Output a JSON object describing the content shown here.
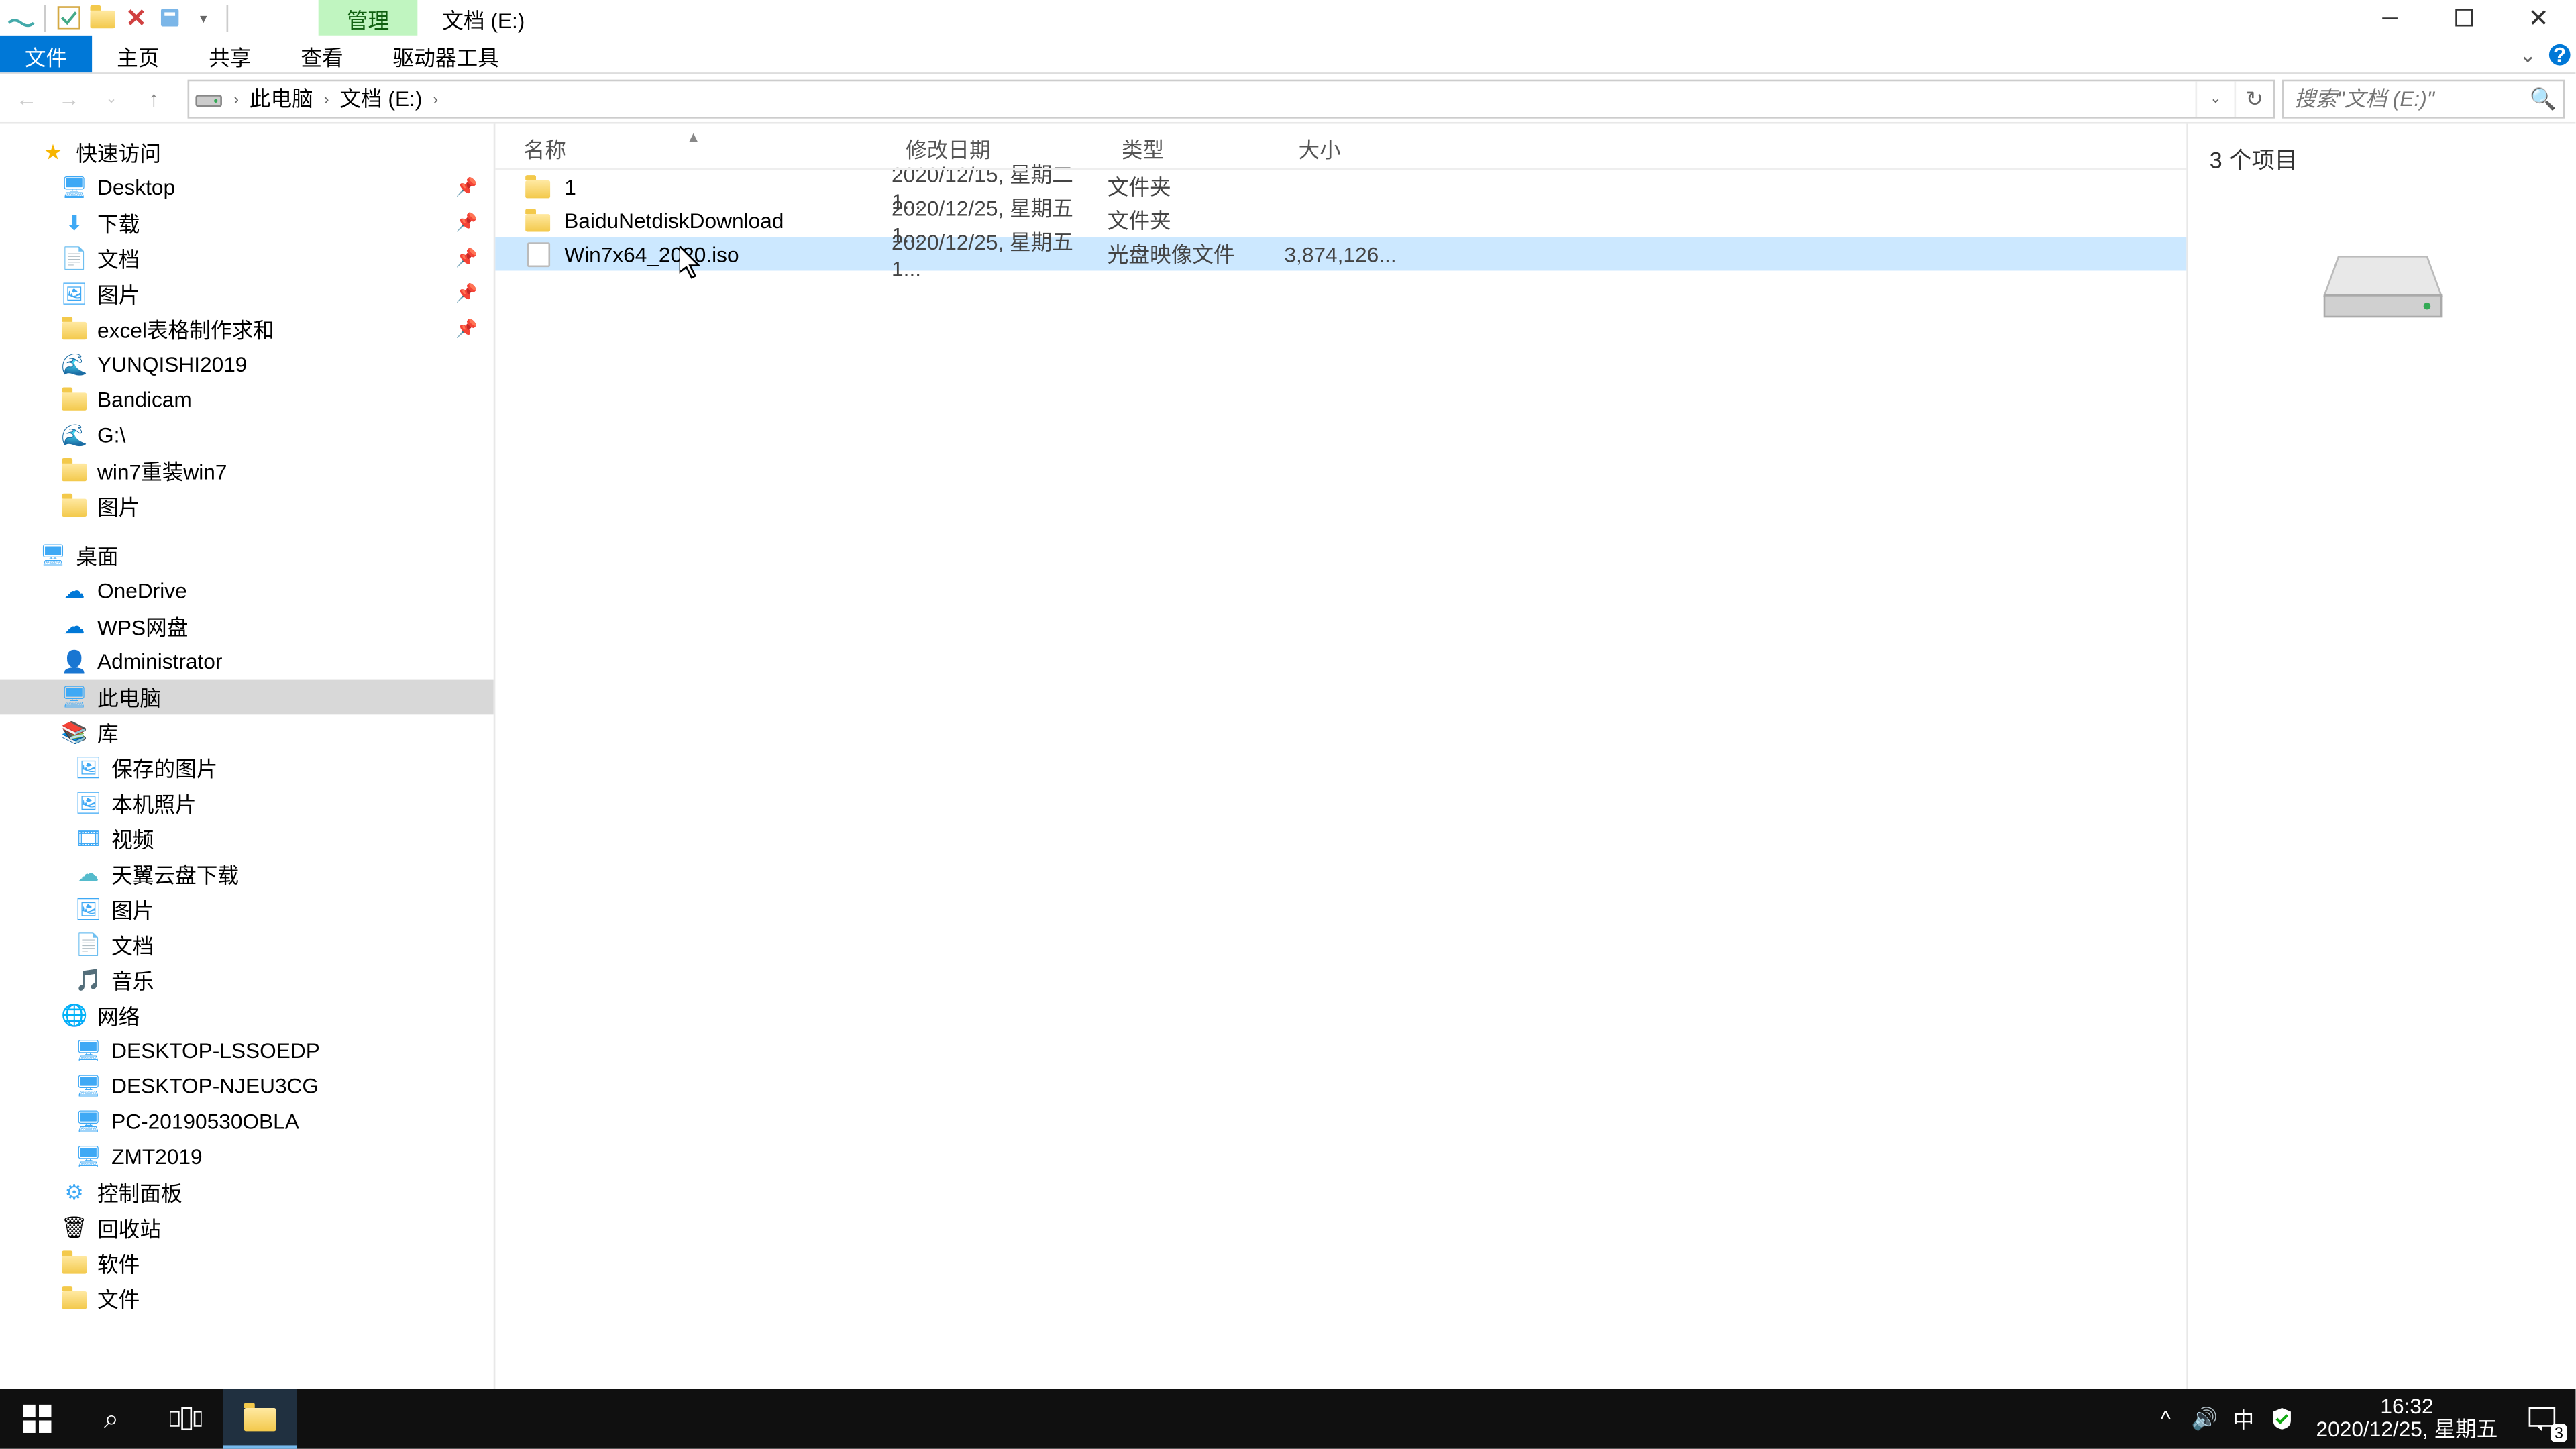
{
  "titlebar": {
    "manage_tab": "管理",
    "location_tab": "文档 (E:)"
  },
  "ribbon": {
    "file": "文件",
    "home": "主页",
    "share": "共享",
    "view": "查看",
    "drive_tools": "驱动器工具"
  },
  "breadcrumb": {
    "this_pc": "此电脑",
    "location": "文档 (E:)"
  },
  "search": {
    "placeholder": "搜索\"文档 (E:)\""
  },
  "nav": {
    "quick_access": "快速访问",
    "desktop": "Desktop",
    "downloads": "下载",
    "documents": "文档",
    "pictures": "图片",
    "excel_folder": "excel表格制作求和",
    "yunqishi": "YUNQISHI2019",
    "bandicam": "Bandicam",
    "g_drive": "G:\\",
    "win7": "win7重装win7",
    "pictures2": "图片",
    "desktop2": "桌面",
    "onedrive": "OneDrive",
    "wps": "WPS网盘",
    "admin": "Administrator",
    "this_pc": "此电脑",
    "libraries": "库",
    "saved_pics": "保存的图片",
    "camera_roll": "本机照片",
    "videos": "视频",
    "tianyi": "天翼云盘下载",
    "lib_pictures": "图片",
    "lib_documents": "文档",
    "music": "音乐",
    "network": "网络",
    "pc1": "DESKTOP-LSSOEDP",
    "pc2": "DESKTOP-NJEU3CG",
    "pc3": "PC-20190530OBLA",
    "pc4": "ZMT2019",
    "control_panel": "控制面板",
    "recycle_bin": "回收站",
    "software": "软件",
    "files": "文件"
  },
  "columns": {
    "name": "名称",
    "date": "修改日期",
    "type": "类型",
    "size": "大小"
  },
  "files": [
    {
      "name": "1",
      "date": "2020/12/15, 星期二 1...",
      "type": "文件夹",
      "size": "",
      "kind": "folder"
    },
    {
      "name": "BaiduNetdiskDownload",
      "date": "2020/12/25, 星期五 1...",
      "type": "文件夹",
      "size": "",
      "kind": "folder"
    },
    {
      "name": "Win7x64_2020.iso",
      "date": "2020/12/25, 星期五 1...",
      "type": "光盘映像文件",
      "size": "3,874,126...",
      "kind": "iso"
    }
  ],
  "preview": {
    "count_text": "3 个项目"
  },
  "status": {
    "text": "3 个项目"
  },
  "taskbar": {
    "time": "16:32",
    "date": "2020/12/25, 星期五",
    "ime": "中",
    "notif_count": "3"
  }
}
